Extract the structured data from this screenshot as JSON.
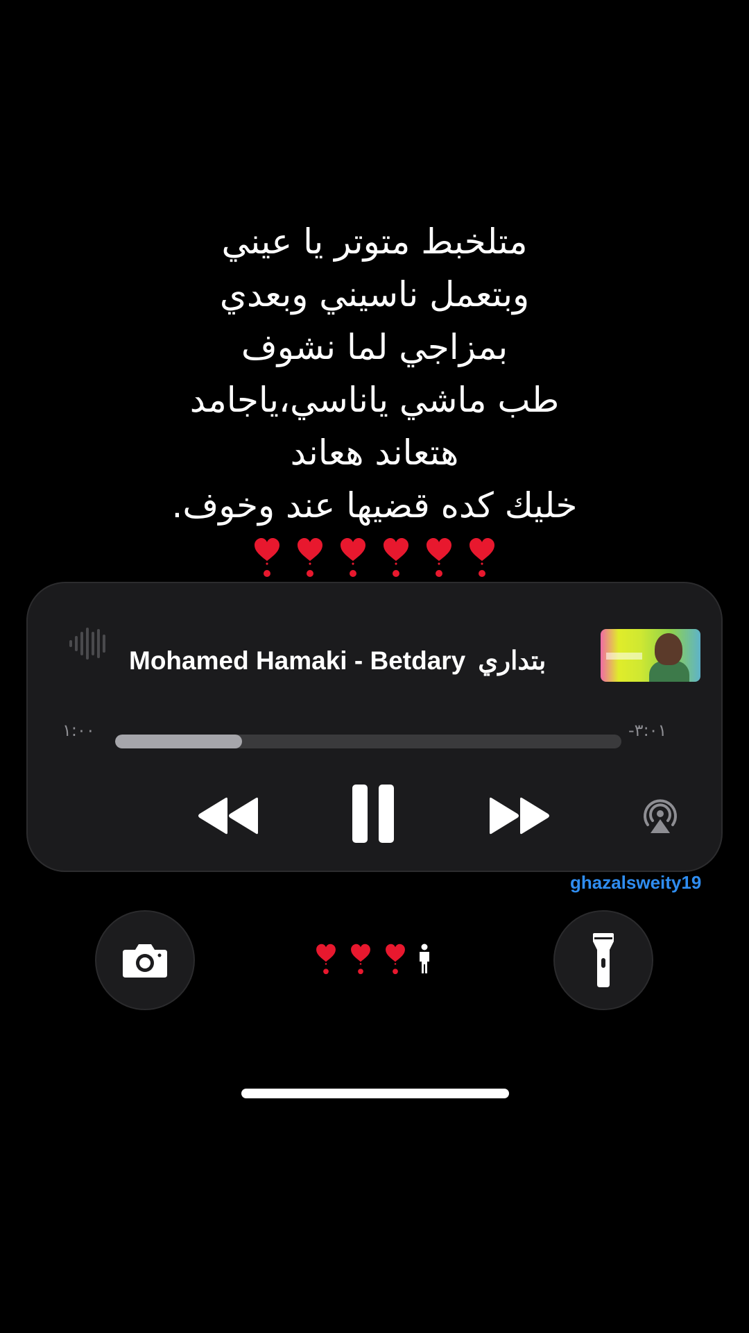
{
  "lyrics": {
    "lines": [
      "متلخبط متوتر يا عيني",
      "وبتعمل ناسيني وبعدي",
      "بمزاجي لما نشوف",
      "طب ماشي ياناسي،ياجامد",
      "هتعاند هعاند",
      "خليك كده قضيها عند وخوف."
    ],
    "heart_emoji": "❣️",
    "heart_count": 6
  },
  "player": {
    "track_title": "Mohamed Hamaki - Betdary",
    "track_title_arabic": "بتداري",
    "elapsed": "١:٠٠",
    "remaining": "-٣:٠١",
    "progress": 0.25,
    "buttons": {
      "rewind": "rewind-icon",
      "pause": "pause-icon",
      "forward": "fast-forward-icon",
      "airplay": "airplay-icon"
    }
  },
  "watermark": {
    "username": "ghazalsweity19"
  },
  "lockscreen": {
    "left_button_icon": "camera-icon",
    "right_button_icon": "flashlight-icon",
    "status_hearts": 3,
    "status_person_icon": "person-icon"
  },
  "colors": {
    "background": "#000000",
    "card": "#1b1b1d",
    "progress_track": "#3a3a3c",
    "progress_fill": "#a6a6ab",
    "heart": "#e8182e",
    "username": "#2f8df0"
  }
}
